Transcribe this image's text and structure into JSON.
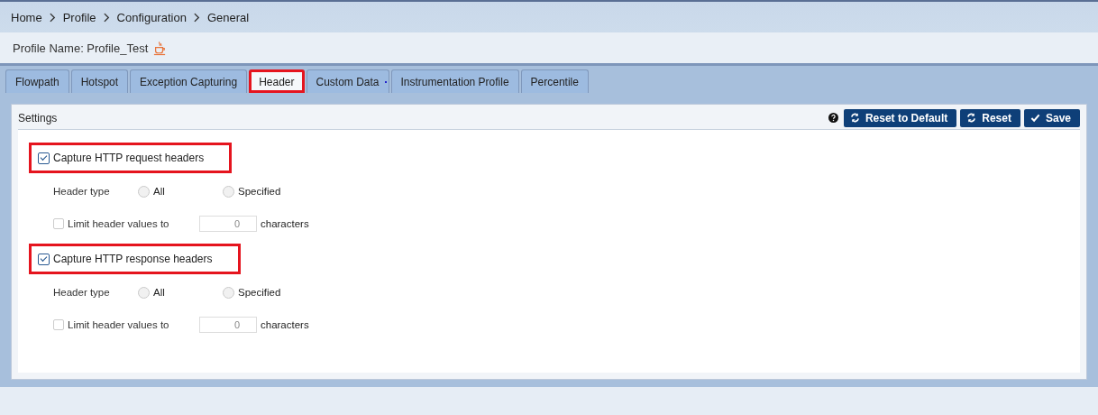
{
  "breadcrumb": [
    "Home",
    "Profile",
    "Configuration",
    "General"
  ],
  "profile_name": "Profile Name: Profile_Test",
  "tabs": [
    {
      "label": "Flowpath",
      "selected": false,
      "highlighted": false,
      "has_dot": false
    },
    {
      "label": "Hotspot",
      "selected": false,
      "highlighted": false,
      "has_dot": false
    },
    {
      "label": "Exception Capturing",
      "selected": false,
      "highlighted": false,
      "has_dot": false
    },
    {
      "label": "Header",
      "selected": true,
      "highlighted": true,
      "has_dot": false
    },
    {
      "label": "Custom Data",
      "selected": false,
      "highlighted": false,
      "has_dot": true
    },
    {
      "label": "Instrumentation Profile",
      "selected": false,
      "highlighted": false,
      "has_dot": false
    },
    {
      "label": "Percentile",
      "selected": false,
      "highlighted": false,
      "has_dot": false
    }
  ],
  "panel": {
    "title": "Settings",
    "buttons": [
      {
        "label": "Reset to Default",
        "kind": "refresh"
      },
      {
        "label": "Reset",
        "kind": "refresh"
      },
      {
        "label": "Save",
        "kind": "check"
      }
    ]
  },
  "sections": [
    {
      "label": "Capture HTTP request headers",
      "checked": true,
      "highlighted": true,
      "header_type": {
        "label": "Header type",
        "disabled": true,
        "options": [
          {
            "label": "All",
            "selected": false
          },
          {
            "label": "Specified",
            "selected": false
          }
        ]
      },
      "limit": {
        "label": "Limit header values to",
        "checked": false,
        "disabled": true,
        "value": "0",
        "unit": "characters"
      }
    },
    {
      "label": "Capture HTTP response headers",
      "checked": true,
      "highlighted": true,
      "header_type": {
        "label": "Header type",
        "disabled": true,
        "options": [
          {
            "label": "All",
            "selected": false
          },
          {
            "label": "Specified",
            "selected": false
          }
        ]
      },
      "limit": {
        "label": "Limit header values to",
        "checked": false,
        "disabled": true,
        "value": "0",
        "unit": "characters"
      }
    }
  ]
}
